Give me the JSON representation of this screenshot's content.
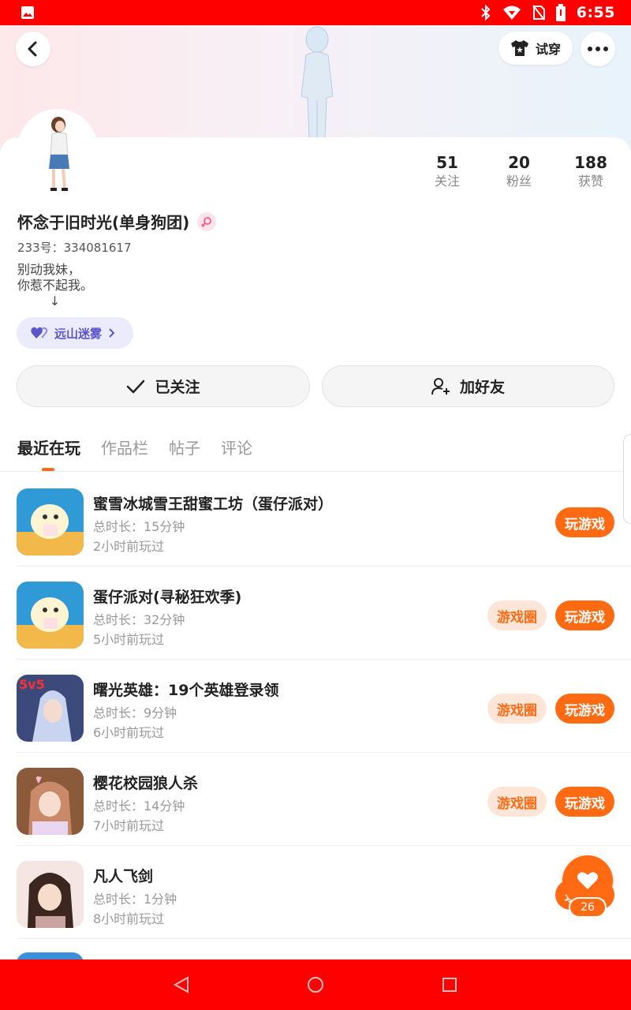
{
  "status_bar": {
    "time": "6:55",
    "icons": [
      "image-icon",
      "bluetooth-icon",
      "wifi-icon",
      "no-sim-icon",
      "battery-icon"
    ]
  },
  "header": {
    "tryon_label": "试穿",
    "icons": [
      "back-icon",
      "tshirt-icon",
      "more-icon"
    ]
  },
  "profile": {
    "stats": [
      {
        "value": "51",
        "label": "关注"
      },
      {
        "value": "20",
        "label": "粉丝"
      },
      {
        "value": "188",
        "label": "获赞"
      }
    ],
    "username": "怀念于旧时光(单身狗团)",
    "uid": "233号：334081617",
    "bio": "别动我妹，\n你惹不起我。\n        ↓",
    "club_tag": "远山迷雾"
  },
  "actions": {
    "follow_label": "已关注",
    "add_friend_label": "加好友"
  },
  "tabs": [
    {
      "label": "最近在玩",
      "active": true
    },
    {
      "label": "作品栏",
      "active": false
    },
    {
      "label": "帖子",
      "active": false
    },
    {
      "label": "评论",
      "active": false
    }
  ],
  "games": [
    {
      "title": "蜜雪冰城雪王甜蜜工坊（蛋仔派对）",
      "duration": "总时长：15分钟",
      "last_played": "2小时前玩过",
      "has_circle": false,
      "play_label": "玩游戏",
      "circle_label": ""
    },
    {
      "title": "蛋仔派对(寻秘狂欢季)",
      "duration": "总时长：32分钟",
      "last_played": "5小时前玩过",
      "has_circle": true,
      "play_label": "玩游戏",
      "circle_label": "游戏圈"
    },
    {
      "title": "曙光英雄：19个英雄登录领",
      "duration": "总时长：9分钟",
      "last_played": "6小时前玩过",
      "has_circle": true,
      "play_label": "玩游戏",
      "circle_label": "游戏圈"
    },
    {
      "title": "樱花校园狼人杀",
      "duration": "总时长：14分钟",
      "last_played": "7小时前玩过",
      "has_circle": true,
      "play_label": "玩游戏",
      "circle_label": "游戏圈"
    },
    {
      "title": "凡人飞剑",
      "duration": "总时长：1分钟",
      "last_played": "8小时前玩过",
      "has_circle": false,
      "play_label": "玩游戏",
      "circle_label": ""
    }
  ],
  "like": {
    "count": "26"
  },
  "colors": {
    "status_bar": "#ff0000",
    "accent": "#ff6a12",
    "circle_bg": "#fde6d8",
    "club_bg": "#ecebfb"
  }
}
